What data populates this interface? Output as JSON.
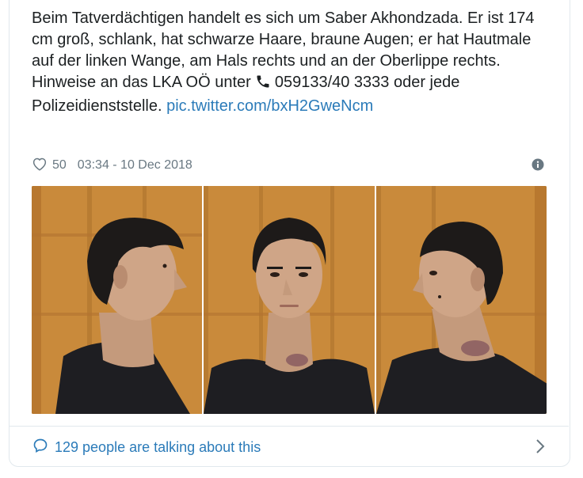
{
  "tweet": {
    "line1": "Beim Tatverdächtigen handelt es sich um Saber Akhondzada. Er ist 174 cm groß, schlank, hat schwarze Haare, braune Augen; er hat Hautmale auf der linken Wange, am Hals rechts und an der Oberlippe rechts.",
    "line2_prefix": "Hinweise an das LKA OÖ unter",
    "phone_number": "059133/40 3333 oder jede Polizeidienststelle.",
    "link_text": "pic.twitter.com/bxH2GweNcm"
  },
  "meta": {
    "likes": "50",
    "timestamp": "03:34 - 10 Dec 2018"
  },
  "footer": {
    "talking": "129 people are talking about this"
  },
  "colors": {
    "link": "#2b7bb9",
    "meta": "#697882",
    "border": "#e1e8ed"
  },
  "icons": [
    "heart-icon",
    "info-icon",
    "phone-icon",
    "speech-bubble-icon",
    "chevron-right-icon"
  ]
}
